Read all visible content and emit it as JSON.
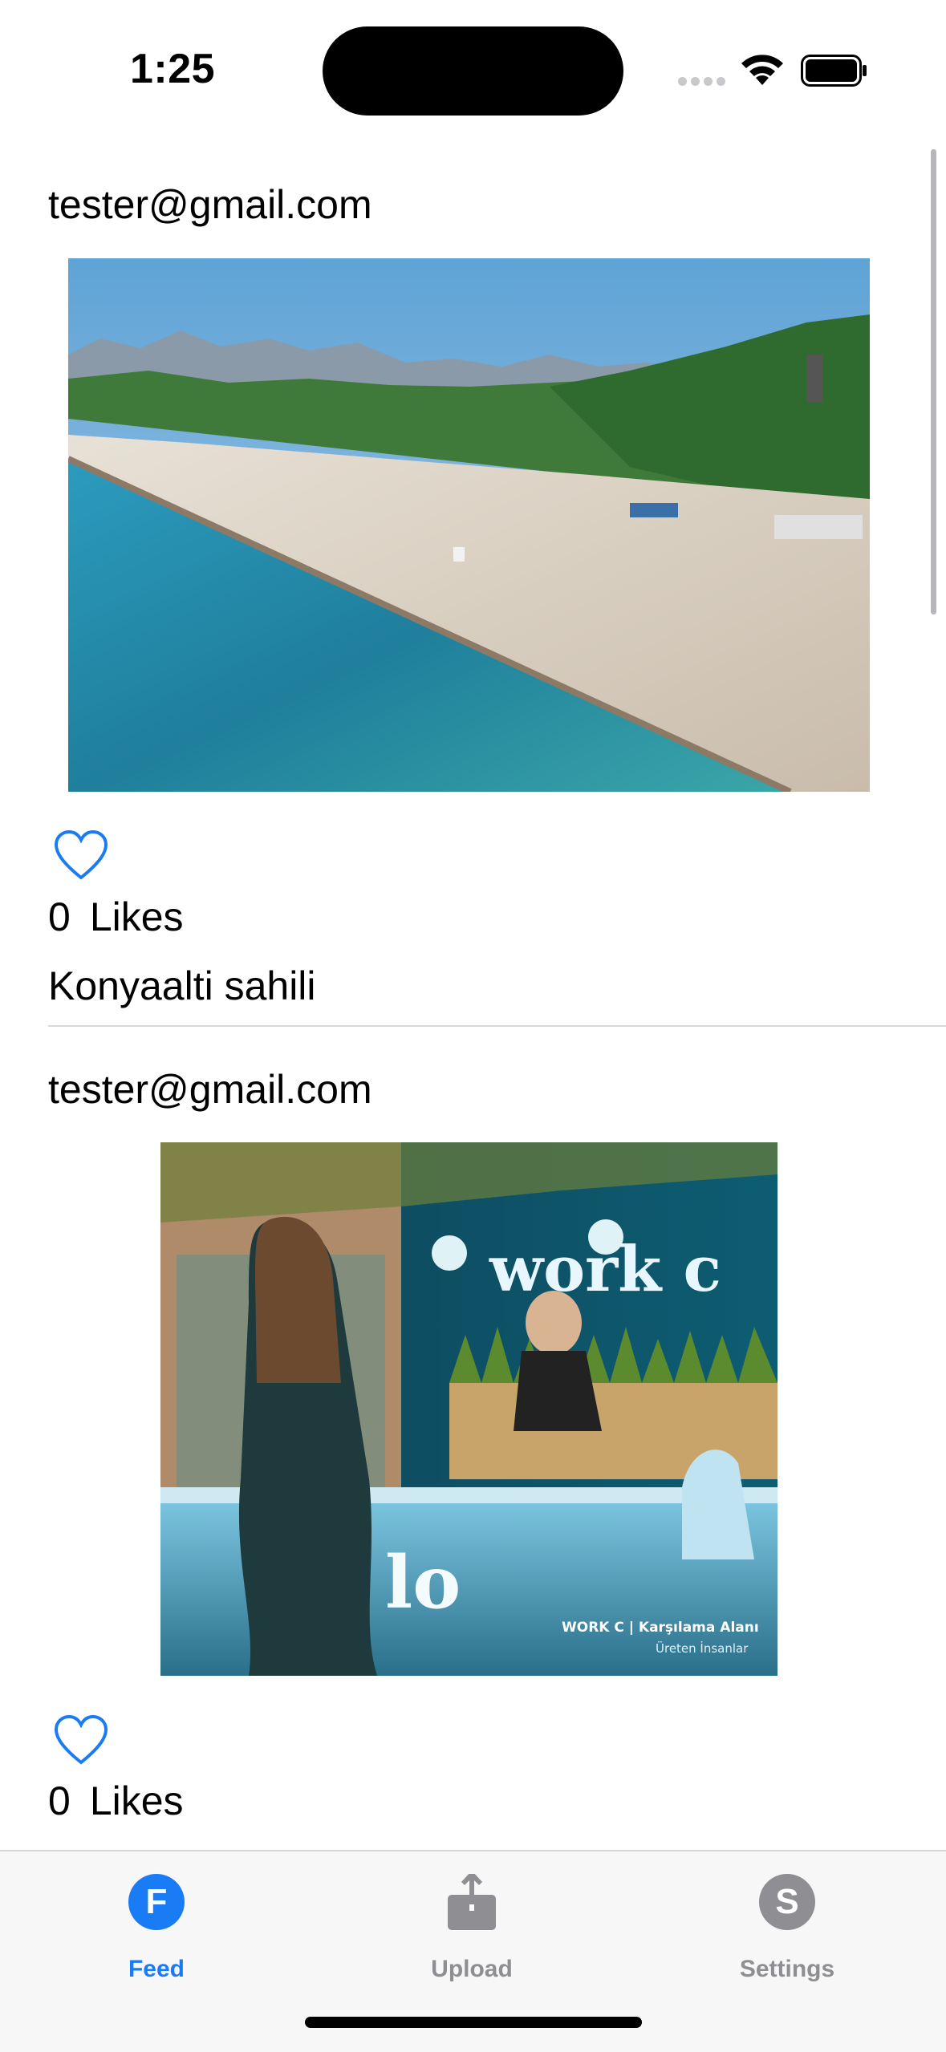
{
  "status_bar": {
    "time": "1:25"
  },
  "feed": {
    "posts": [
      {
        "email": "tester@gmail.com",
        "likes_count": "0",
        "likes_label": "Likes",
        "caption": "Konyaalti sahili"
      },
      {
        "email": "tester@gmail.com",
        "likes_count": "0",
        "likes_label": "Likes",
        "image_text": "work c",
        "image_subtext_1": "WORK C | Karşılama Alanı",
        "image_subtext_2": "Üreten İnsanlar",
        "counter_letters": "lo"
      }
    ]
  },
  "tab_bar": {
    "tabs": [
      {
        "label": "Feed",
        "icon_letter": "F",
        "icon": "f-circle-icon",
        "active": true
      },
      {
        "label": "Upload",
        "icon": "upload-icon",
        "active": false
      },
      {
        "label": "Settings",
        "icon_letter": "S",
        "icon": "s-circle-icon",
        "active": false
      }
    ]
  },
  "colors": {
    "accent": "#1a7cf5",
    "inactive": "#8e8e93"
  }
}
